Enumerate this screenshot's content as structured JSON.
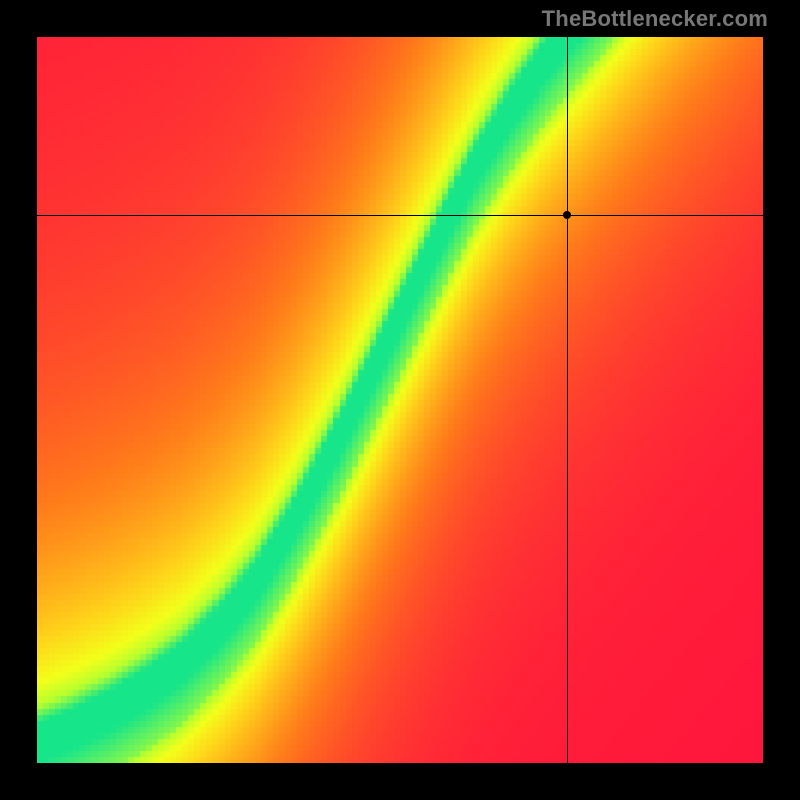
{
  "watermark": {
    "text": "TheBottlenecker.com"
  },
  "chart_data": {
    "type": "heatmap",
    "title": "",
    "xlabel": "",
    "ylabel": "",
    "xlim": [
      0,
      1
    ],
    "ylim": [
      0,
      1
    ],
    "grid_resolution": 120,
    "marker": {
      "x": 0.73,
      "y": 0.755
    },
    "crosshair": {
      "x": 0.73,
      "y": 0.755
    },
    "colorscale": [
      {
        "t": 0.0,
        "color": "#ff153c"
      },
      {
        "t": 0.4,
        "color": "#ff7a1a"
      },
      {
        "t": 0.7,
        "color": "#ffd11a"
      },
      {
        "t": 0.85,
        "color": "#f3ff1a"
      },
      {
        "t": 0.93,
        "color": "#b7ff2e"
      },
      {
        "t": 1.0,
        "color": "#17e58a"
      }
    ],
    "ridge": {
      "description": "Normalized y-position of the green optimum center as a function of x; the heat value falls off with distance from this ridge.",
      "points": [
        {
          "x": 0.0,
          "y": 0.0
        },
        {
          "x": 0.05,
          "y": 0.02
        },
        {
          "x": 0.1,
          "y": 0.045
        },
        {
          "x": 0.15,
          "y": 0.075
        },
        {
          "x": 0.2,
          "y": 0.11
        },
        {
          "x": 0.25,
          "y": 0.16
        },
        {
          "x": 0.3,
          "y": 0.22
        },
        {
          "x": 0.35,
          "y": 0.3
        },
        {
          "x": 0.4,
          "y": 0.39
        },
        {
          "x": 0.45,
          "y": 0.49
        },
        {
          "x": 0.5,
          "y": 0.59
        },
        {
          "x": 0.55,
          "y": 0.69
        },
        {
          "x": 0.6,
          "y": 0.79
        },
        {
          "x": 0.65,
          "y": 0.87
        },
        {
          "x": 0.7,
          "y": 0.94
        },
        {
          "x": 0.75,
          "y": 1.0
        },
        {
          "x": 0.8,
          "y": 1.06
        },
        {
          "x": 0.85,
          "y": 1.12
        },
        {
          "x": 0.9,
          "y": 1.18
        },
        {
          "x": 0.95,
          "y": 1.24
        },
        {
          "x": 1.0,
          "y": 1.3
        }
      ],
      "band_half_width": 0.055,
      "falloff_softness": 0.33
    }
  }
}
